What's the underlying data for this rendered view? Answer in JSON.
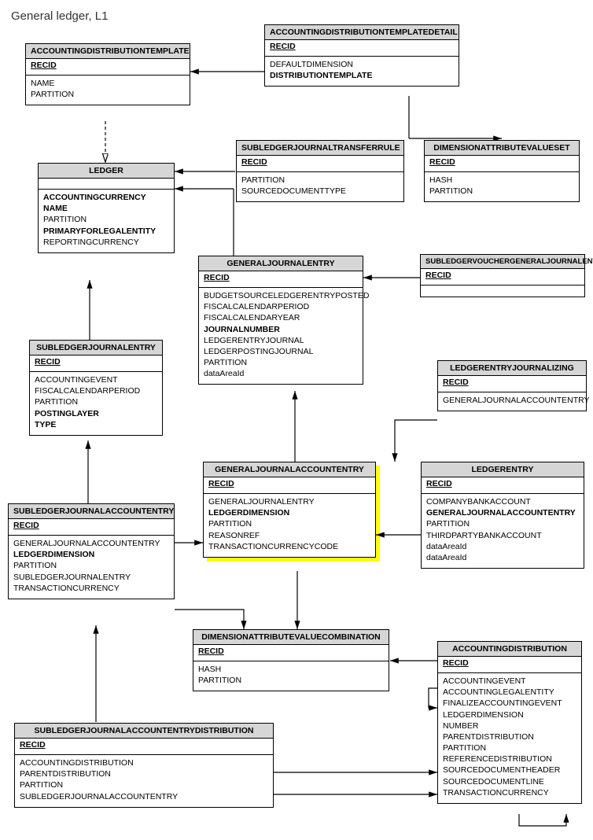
{
  "page_title": "General ledger, L1",
  "entities": {
    "accountingdistributiontemplate": {
      "name": "ACCOUNTINGDISTRIBUTIONTEMPLATE",
      "key": "RECID",
      "fields": [
        {
          "t": "NAME"
        },
        {
          "t": "PARTITION"
        }
      ]
    },
    "accountingdistributiontemplatedetail": {
      "name": "ACCOUNTINGDISTRIBUTIONTEMPLATEDETAIL",
      "key": "RECID",
      "fields": [
        {
          "t": "DEFAULTDIMENSION"
        },
        {
          "t": "DISTRIBUTIONTEMPLATE",
          "b": true
        }
      ]
    },
    "ledger": {
      "name": "LEDGER",
      "key": "",
      "fields": [
        {
          "t": "ACCOUNTINGCURRENCY",
          "b": true
        },
        {
          "t": "NAME",
          "b": true
        },
        {
          "t": "PARTITION"
        },
        {
          "t": "PRIMARYFORLEGALENTITY",
          "b": true
        },
        {
          "t": "REPORTINGCURRENCY"
        }
      ]
    },
    "subledgerjournaltransferrule": {
      "name": "SUBLEDGERJOURNALTRANSFERRULE",
      "key": "RECID",
      "fields": [
        {
          "t": "PARTITION"
        },
        {
          "t": "SOURCEDOCUMENTTYPE"
        }
      ]
    },
    "dimensionattributevalueset": {
      "name": "DIMENSIONATTRIBUTEVALUESET",
      "key": "RECID",
      "fields": [
        {
          "t": "HASH"
        },
        {
          "t": "PARTITION"
        }
      ]
    },
    "generaljournalentry": {
      "name": "GENERALJOURNALENTRY",
      "key": "RECID",
      "fields": [
        {
          "t": "BUDGETSOURCELEDGERENTRYPOSTED"
        },
        {
          "t": "FISCALCALENDARPERIOD"
        },
        {
          "t": "FISCALCALENDARYEAR"
        },
        {
          "t": "JOURNALNUMBER",
          "b": true
        },
        {
          "t": "LEDGERENTRYJOURNAL"
        },
        {
          "t": "LEDGERPOSTINGJOURNAL"
        },
        {
          "t": "PARTITION"
        },
        {
          "t": "dataAreaId"
        }
      ]
    },
    "subledgervouchergeneraljournalentry": {
      "name": "SUBLEDGERVOUCHERGENERALJOURNALENTRY",
      "key": "RECID",
      "fields": []
    },
    "subledgerjournalentry": {
      "name": "SUBLEDGERJOURNALENTRY",
      "key": "RECID",
      "fields": [
        {
          "t": "ACCOUNTINGEVENT"
        },
        {
          "t": "FISCALCALENDARPERIOD"
        },
        {
          "t": "PARTITION"
        },
        {
          "t": "POSTINGLAYER",
          "b": true
        },
        {
          "t": "TYPE",
          "b": true
        }
      ]
    },
    "ledgerentryjournalizing": {
      "name": "LEDGERENTRYJOURNALIZING",
      "key": "RECID",
      "fields": [
        {
          "t": "GENERALJOURNALACCOUNTENTRY"
        }
      ]
    },
    "generaljournalaccountentry": {
      "name": "GENERALJOURNALACCOUNTENTRY",
      "key": "RECID",
      "fields": [
        {
          "t": "GENERALJOURNALENTRY"
        },
        {
          "t": "LEDGERDIMENSION",
          "b": true
        },
        {
          "t": "PARTITION"
        },
        {
          "t": "REASONREF"
        },
        {
          "t": "TRANSACTIONCURRENCYCODE"
        }
      ]
    },
    "ledgerentry": {
      "name": "LEDGERENTRY",
      "key": "RECID",
      "fields": [
        {
          "t": "COMPANYBANKACCOUNT"
        },
        {
          "t": "GENERALJOURNALACCOUNTENTRY",
          "b": true
        },
        {
          "t": "PARTITION"
        },
        {
          "t": "THIRDPARTYBANKACCOUNT"
        },
        {
          "t": "dataAreaId"
        },
        {
          "t": "dataAreaId"
        }
      ]
    },
    "subledgerjournalaccountentry": {
      "name": "SUBLEDGERJOURNALACCOUNTENTRY",
      "key": "RECID",
      "fields": [
        {
          "t": "GENERALJOURNALACCOUNTENTRY"
        },
        {
          "t": "LEDGERDIMENSION",
          "b": true
        },
        {
          "t": "PARTITION"
        },
        {
          "t": "SUBLEDGERJOURNALENTRY"
        },
        {
          "t": "TRANSACTIONCURRENCY"
        }
      ]
    },
    "dimensionattributevaluecombination": {
      "name": "DIMENSIONATTRIBUTEVALUECOMBINATION",
      "key": "RECID",
      "fields": [
        {
          "t": "HASH"
        },
        {
          "t": "PARTITION"
        }
      ]
    },
    "accountingdistribution": {
      "name": "ACCOUNTINGDISTRIBUTION",
      "key": "RECID",
      "fields": [
        {
          "t": "ACCOUNTINGEVENT"
        },
        {
          "t": "ACCOUNTINGLEGALENTITY"
        },
        {
          "t": "FINALIZEACCOUNTINGEVENT"
        },
        {
          "t": "LEDGERDIMENSION"
        },
        {
          "t": "NUMBER"
        },
        {
          "t": "PARENTDISTRIBUTION"
        },
        {
          "t": "PARTITION"
        },
        {
          "t": "REFERENCEDISTRIBUTION"
        },
        {
          "t": "SOURCEDOCUMENTHEADER"
        },
        {
          "t": "SOURCEDOCUMENTLINE"
        },
        {
          "t": "TRANSACTIONCURRENCY"
        }
      ]
    },
    "subledgerjournalaccountentrydistribution": {
      "name": "SUBLEDGERJOURNALACCOUNTENTRYDISTRIBUTION",
      "key": "RECID",
      "fields": [
        {
          "t": "ACCOUNTINGDISTRIBUTION"
        },
        {
          "t": "PARENTDISTRIBUTION"
        },
        {
          "t": "PARTITION"
        },
        {
          "t": "SUBLEDGERJOURNALACCOUNTENTRY"
        }
      ]
    }
  }
}
